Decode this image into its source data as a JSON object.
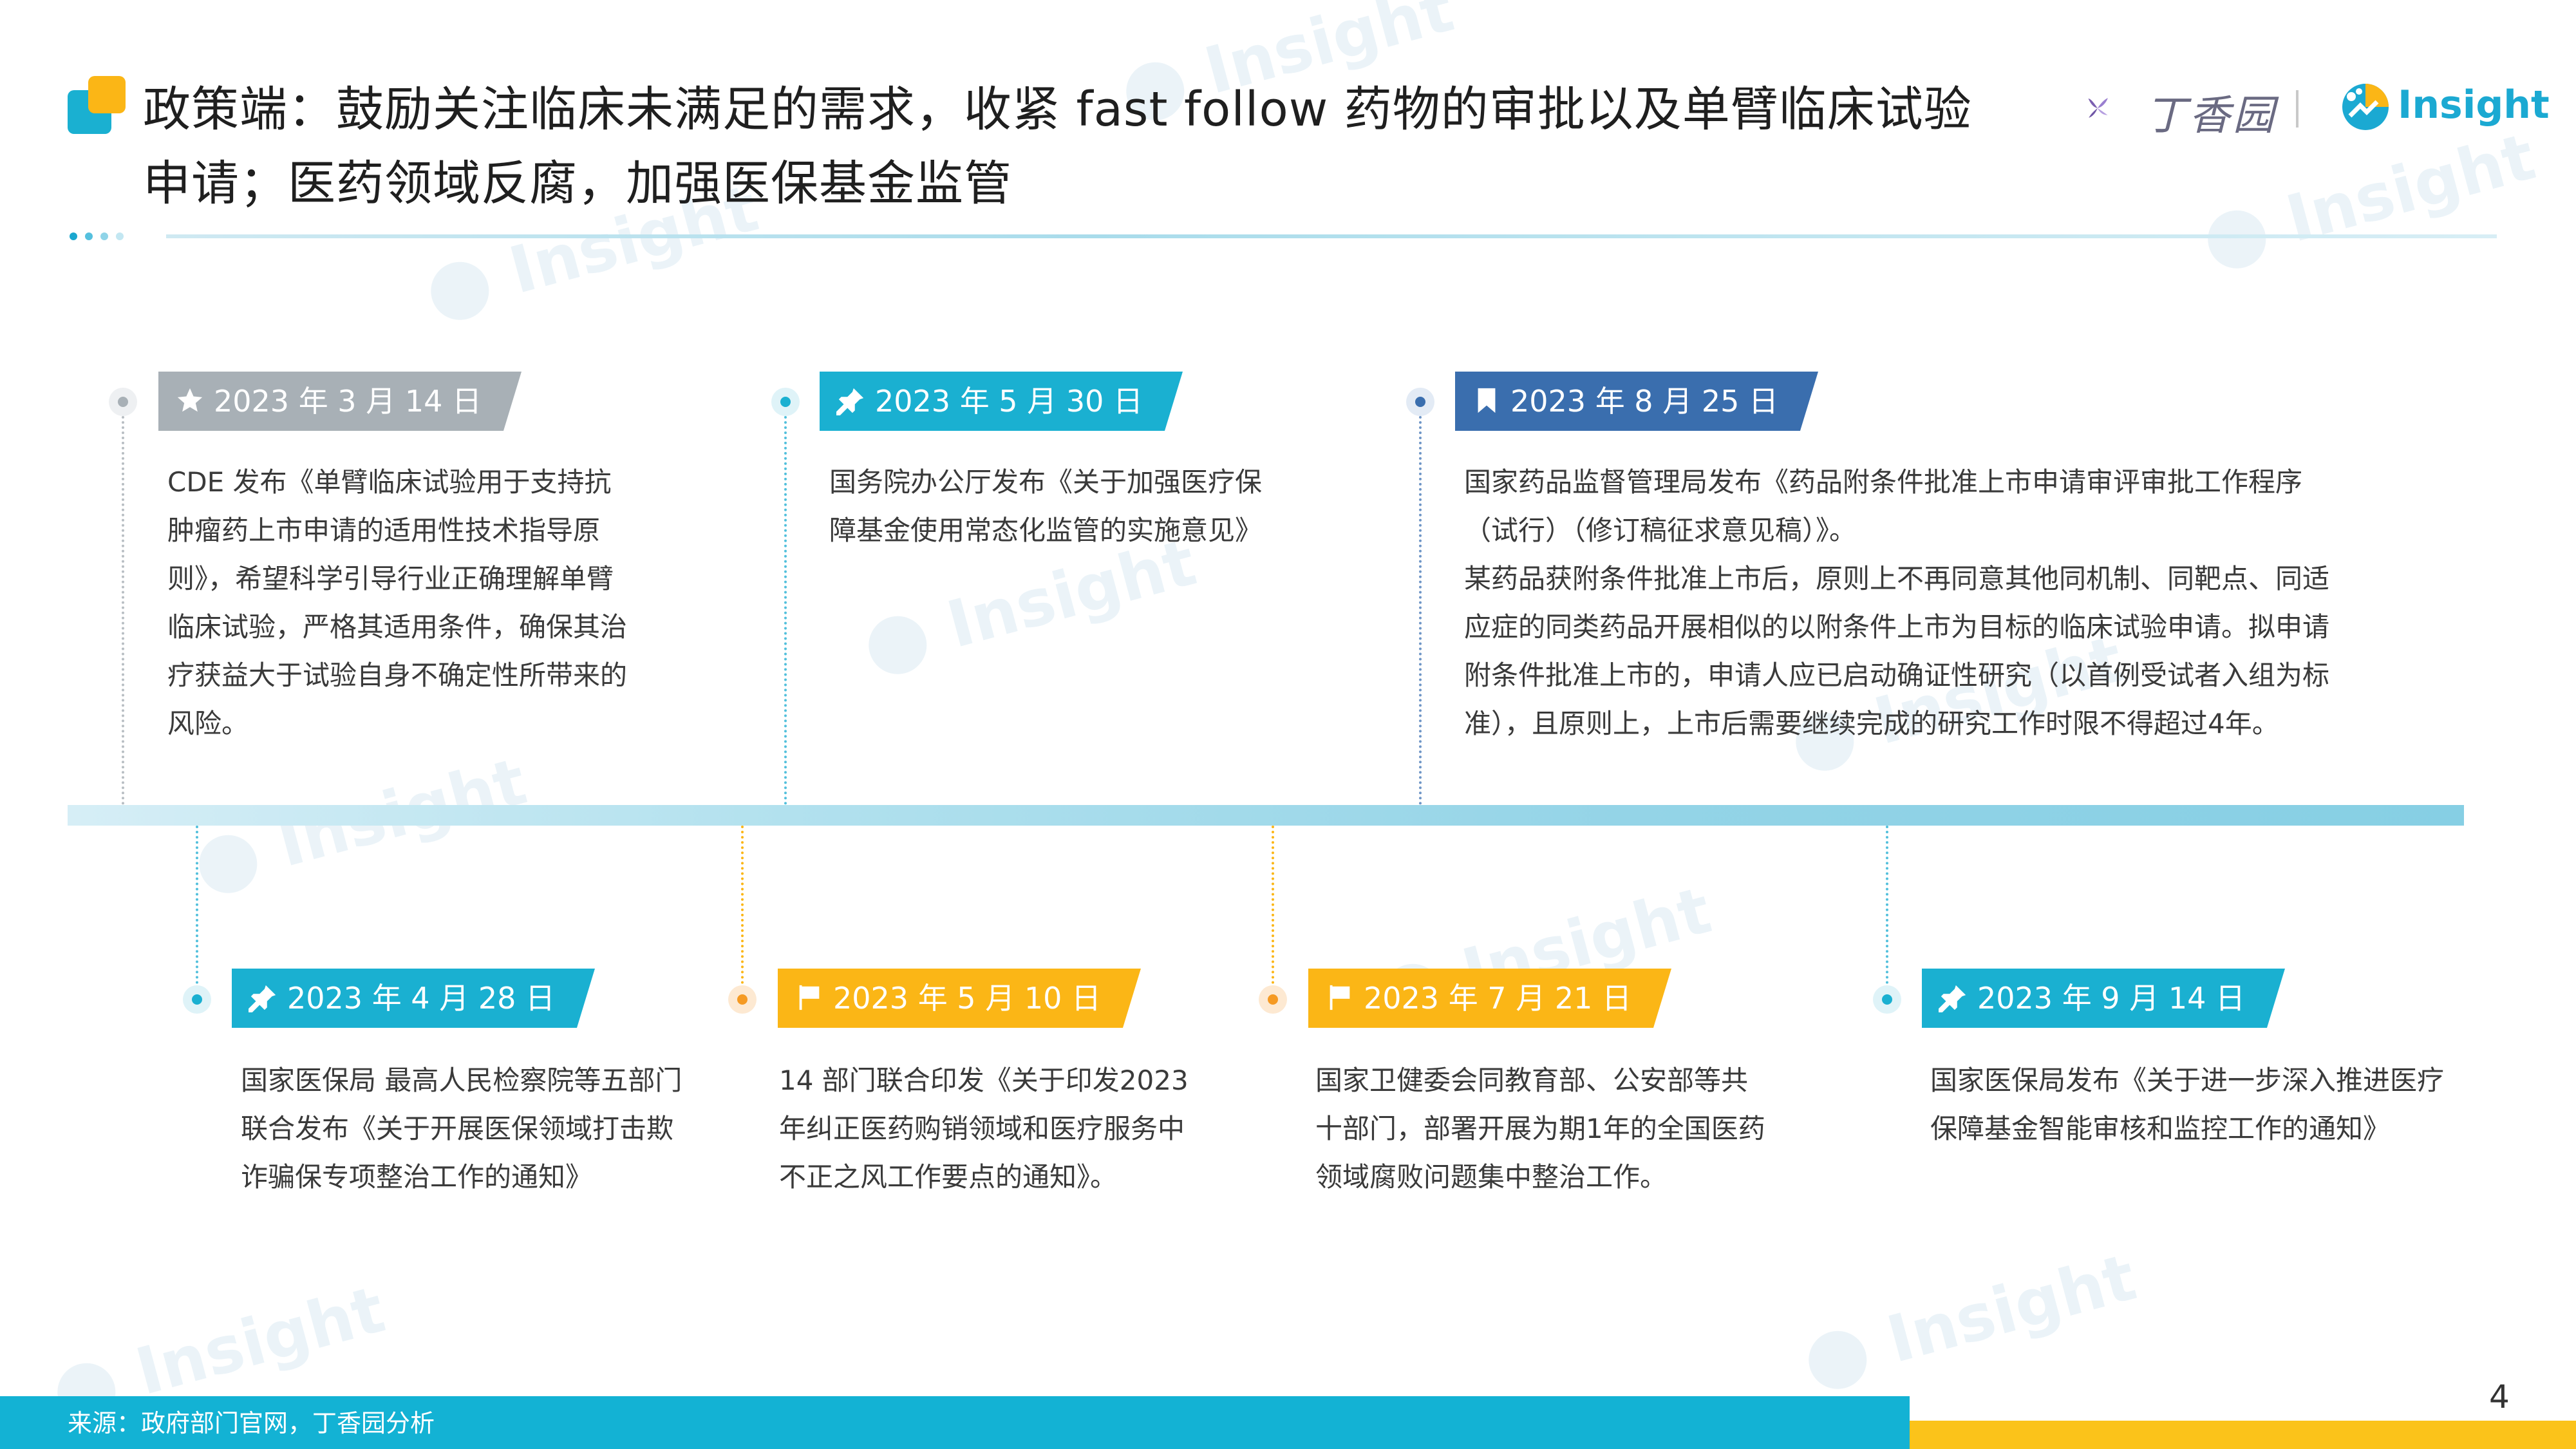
{
  "title": {
    "line1": "政策端：鼓励关注临床未满足的需求，收紧 fast follow 药物的审批以及单臂临床试验",
    "line2": "申请；医药领域反腐，加强医保基金监管"
  },
  "logos": {
    "dxy_text": "丁香园",
    "insight_text": "Insight"
  },
  "watermark_text": "Insight",
  "colors": {
    "gray": "#a8b0b6",
    "cyan": "#1ab0d1",
    "navy": "#3a6eae",
    "orange": "#fbb616",
    "footer": "#13b2d4",
    "footer_accent": "#fbc31a"
  },
  "events_top": [
    {
      "date": "2023 年 3 月 14 日",
      "icon": "star-icon",
      "color": "gray",
      "text": "CDE 发布《单臂临床试验用于支持抗肿瘤药上市申请的适用性技术指导原则》，希望科学引导行业正确理解单臂临床试验，严格其适用条件，确保其治疗获益大于试验自身不确定性所带来的风险。"
    },
    {
      "date": "2023 年 5 月 30 日",
      "icon": "pin-icon",
      "color": "cyan",
      "text": "国务院办公厅发布《关于加强医疗保障基金使用常态化监管的实施意见》"
    },
    {
      "date": "2023 年 8 月 25 日",
      "icon": "bookmark-icon",
      "color": "navy",
      "text": "国家药品监督管理局发布《药品附条件批准上市申请审评审批工作程序（试行）（修订稿征求意见稿）》。",
      "text2": "某药品获附条件批准上市后，原则上不再同意其他同机制、同靶点、同适应症的同类药品开展相似的以附条件上市为目标的临床试验申请。拟申请附条件批准上市的，申请人应已启动确证性研究（以首例受试者入组为标准），且原则上，上市后需要继续完成的研究工作时限不得超过4年。"
    }
  ],
  "events_bottom": [
    {
      "date": "2023 年 4 月 28 日",
      "icon": "pin-icon",
      "color": "cyan",
      "text": "国家医保局  最高人民检察院等五部门联合发布《关于开展医保领域打击欺诈骗保专项整治工作的通知》"
    },
    {
      "date": "2023 年 5 月 10 日",
      "icon": "flag-icon",
      "color": "orange",
      "text": "14 部门联合印发《关于印发2023年纠正医药购销领域和医疗服务中不正之风工作要点的通知》。"
    },
    {
      "date": "2023 年 7 月 21 日",
      "icon": "flag-icon",
      "color": "orange",
      "text": "国家卫健委会同教育部、公安部等共十部门，部署开展为期1年的全国医药领域腐败问题集中整治工作。"
    },
    {
      "date": "2023 年 9 月 14 日",
      "icon": "pin-icon",
      "color": "cyan",
      "text": "国家医保局发布《关于进一步深入推进医疗保障基金智能审核和监控工作的通知》"
    }
  ],
  "footer": {
    "source": "来源：政府部门官网，丁香园分析",
    "page_number": "4"
  }
}
